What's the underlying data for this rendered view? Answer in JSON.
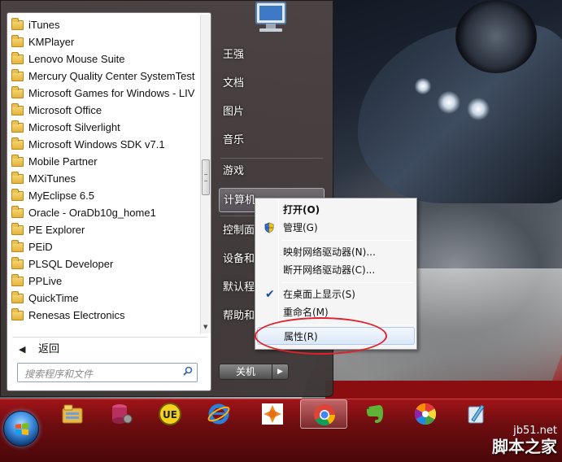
{
  "start_menu": {
    "programs": [
      {
        "label": "iTunes"
      },
      {
        "label": "KMPlayer"
      },
      {
        "label": "Lenovo Mouse Suite"
      },
      {
        "label": "Mercury Quality Center SystemTest"
      },
      {
        "label": "Microsoft Games for Windows - LIV"
      },
      {
        "label": "Microsoft Office"
      },
      {
        "label": "Microsoft Silverlight"
      },
      {
        "label": "Microsoft Windows SDK v7.1"
      },
      {
        "label": "Mobile Partner"
      },
      {
        "label": "MXiTunes"
      },
      {
        "label": "MyEclipse 6.5"
      },
      {
        "label": "Oracle - OraDb10g_home1"
      },
      {
        "label": "PE Explorer"
      },
      {
        "label": "PEiD"
      },
      {
        "label": "PLSQL Developer"
      },
      {
        "label": "PPLive"
      },
      {
        "label": "QuickTime"
      },
      {
        "label": "Renesas Electronics"
      }
    ],
    "back_label": "返回",
    "search_placeholder": "搜索程序和文件",
    "right_items": [
      {
        "label": "王强"
      },
      {
        "label": "文档"
      },
      {
        "label": "图片"
      },
      {
        "label": "音乐"
      },
      {
        "label": "游戏"
      },
      {
        "label": "计算机"
      },
      {
        "label": "控制面板"
      },
      {
        "label": "设备和打印机"
      },
      {
        "label": "默认程序"
      },
      {
        "label": "帮助和支持"
      }
    ],
    "shutdown_label": "关机"
  },
  "context_menu": {
    "items": [
      {
        "label": "打开(O)"
      },
      {
        "label": "管理(G)"
      },
      {
        "label": "映射网络驱动器(N)..."
      },
      {
        "label": "断开网络驱动器(C)..."
      },
      {
        "label": "在桌面上显示(S)"
      },
      {
        "label": "重命名(M)"
      },
      {
        "label": "属性(R)"
      }
    ]
  },
  "taskbar": {
    "apps": [
      "file-explorer-icon",
      "database-icon",
      "ultraedit-icon",
      "internet-explorer-icon",
      "tool-icon",
      "chrome-icon",
      "evernote-icon",
      "color-wheel-icon",
      "pen-icon"
    ]
  },
  "watermark": {
    "url": "jb51.net",
    "name": "脚本之家"
  },
  "colors": {
    "taskbar": "#8a0e10",
    "highlight_ellipse": "#e0202a",
    "menu_hover": "#dbe8f7"
  }
}
